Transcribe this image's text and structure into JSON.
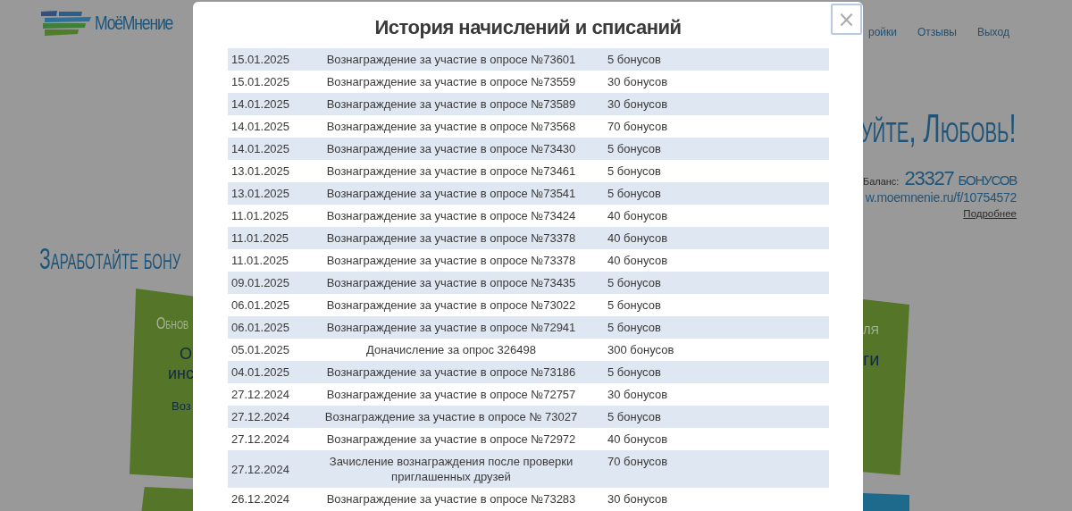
{
  "header": {
    "logo_text": "МоёМнение",
    "nav": [
      "ройки",
      "Отзывы",
      "Выход"
    ]
  },
  "greeting": "уйте, Любовь!",
  "balance": {
    "label": "Баланс:",
    "value": "23327 бонусов"
  },
  "referral_link": "w.moemnenie.ru/f/10754572",
  "more_link": "Подробнее",
  "section_title": "Заработайте бону",
  "left_card": {
    "subtitle": "Обнов",
    "title_lines": [
      "О",
      "инс"
    ],
    "text": "Воз"
  },
  "right_card": {
    "subtitle": "ля",
    "title": "ги"
  },
  "modal": {
    "title": "История начислений и списаний",
    "close": "×",
    "rows": [
      {
        "date": "15.01.2025",
        "description": "Вознаграждение за участие в опросе №73601",
        "amount": "5 бонусов"
      },
      {
        "date": "15.01.2025",
        "description": "Вознаграждение за участие в опросе №73559",
        "amount": "30 бонусов"
      },
      {
        "date": "14.01.2025",
        "description": "Вознаграждение за участие в опросе №73589",
        "amount": "30 бонусов"
      },
      {
        "date": "14.01.2025",
        "description": "Вознаграждение за участие в опросе №73568",
        "amount": "70 бонусов"
      },
      {
        "date": "14.01.2025",
        "description": "Вознаграждение за участие в опросе №73430",
        "amount": "5 бонусов"
      },
      {
        "date": "13.01.2025",
        "description": "Вознаграждение за участие в опросе №73461",
        "amount": "5 бонусов"
      },
      {
        "date": "13.01.2025",
        "description": "Вознаграждение за участие в опросе №73541",
        "amount": "5 бонусов"
      },
      {
        "date": "11.01.2025",
        "description": "Вознаграждение за участие в опросе №73424",
        "amount": "40 бонусов"
      },
      {
        "date": "11.01.2025",
        "description": "Вознаграждение за участие в опросе №73378",
        "amount": "40 бонусов"
      },
      {
        "date": "11.01.2025",
        "description": "Вознаграждение за участие в опросе №73378",
        "amount": "40 бонусов"
      },
      {
        "date": "09.01.2025",
        "description": "Вознаграждение за участие в опросе №73435",
        "amount": "5 бонусов"
      },
      {
        "date": "06.01.2025",
        "description": "Вознаграждение за участие в опросе №73022",
        "amount": "5 бонусов"
      },
      {
        "date": "06.01.2025",
        "description": "Вознаграждение за участие в опросе №72941",
        "amount": "5 бонусов"
      },
      {
        "date": "05.01.2025",
        "description": "Доначисление за опрос 326498",
        "amount": "300 бонусов"
      },
      {
        "date": "04.01.2025",
        "description": "Вознаграждение за участие в опросе №73186",
        "amount": "5 бонусов"
      },
      {
        "date": "27.12.2024",
        "description": "Вознаграждение за участие в опросе №72757",
        "amount": "30 бонусов"
      },
      {
        "date": "27.12.2024",
        "description": "Вознаграждение за участие в опросе № 73027",
        "amount": "5 бонусов"
      },
      {
        "date": "27.12.2024",
        "description": "Вознаграждение за участие в опросе №72972",
        "amount": "40 бонусов"
      },
      {
        "date": "27.12.2024",
        "description": "Зачисление вознаграждения после проверки приглашенных друзей",
        "amount": "70 бонусов"
      },
      {
        "date": "26.12.2024",
        "description": "Вознаграждение за участие в опросе №73283",
        "amount": "30 бонусов"
      }
    ]
  }
}
